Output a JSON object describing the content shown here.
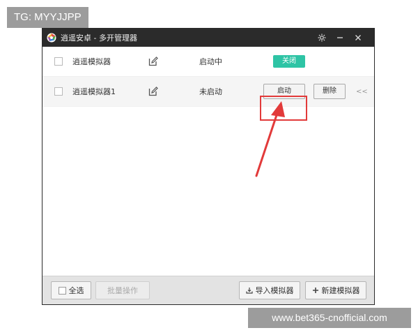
{
  "watermarks": {
    "top": "TG: MYYJJPP",
    "bottom": "www.bet365-cnofficial.com"
  },
  "window": {
    "title": "逍遥安卓 - 多开管理器",
    "controls": [
      "settings-icon",
      "minimize-icon",
      "close-icon"
    ]
  },
  "rows": [
    {
      "name": "逍遥模拟器",
      "status": "启动中",
      "action_label": "关闭"
    },
    {
      "name": "逍遥模拟器1",
      "status": "未启动",
      "action_label": "启动",
      "delete_label": "删除",
      "collapse_glyph": "<<"
    }
  ],
  "footer": {
    "select_all": "全选",
    "batch": "批量操作",
    "import": "导入模拟器",
    "new": "新建模拟器"
  },
  "colors": {
    "titlebar": "#2b2b2b",
    "accent_green": "#2ec4a5",
    "highlight_red": "#e23a3a"
  }
}
